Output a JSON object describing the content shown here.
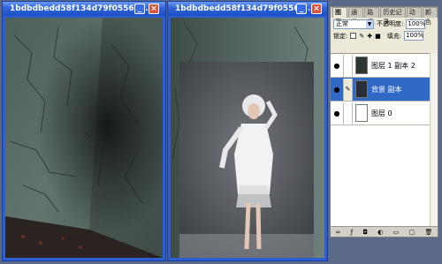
{
  "windows": [
    {
      "title": "1bdbdbedd58f134d79f05569 ...",
      "min_label": "_",
      "close_label": "×"
    },
    {
      "title": "1bdbdbedd58f134d79f05569 ...",
      "min_label": "_",
      "close_label": "×"
    }
  ],
  "layers_panel": {
    "tabs": [
      "图层",
      "通道",
      "路径",
      "历史记录",
      "动作",
      "颜色"
    ],
    "blend_mode": "正常",
    "opacity_label": "不透明度:",
    "opacity_value": "100%",
    "lock_label": "锁定:",
    "fill_label": "填充:",
    "fill_value": "100%",
    "layers": [
      {
        "name": "图层 1 副本 2",
        "selected": false
      },
      {
        "name": "背景 副本",
        "selected": true
      },
      {
        "name": "图层 0",
        "selected": false
      }
    ],
    "footer_icons": [
      "link-icon",
      "fx-icon",
      "mask-icon",
      "adjust-icon",
      "folder-icon",
      "new-layer-icon",
      "trash-icon"
    ]
  },
  "colors": {
    "titlebar": "#2f64d8",
    "selected_layer": "#3169c6",
    "panel_bg": "#ece9d8"
  }
}
